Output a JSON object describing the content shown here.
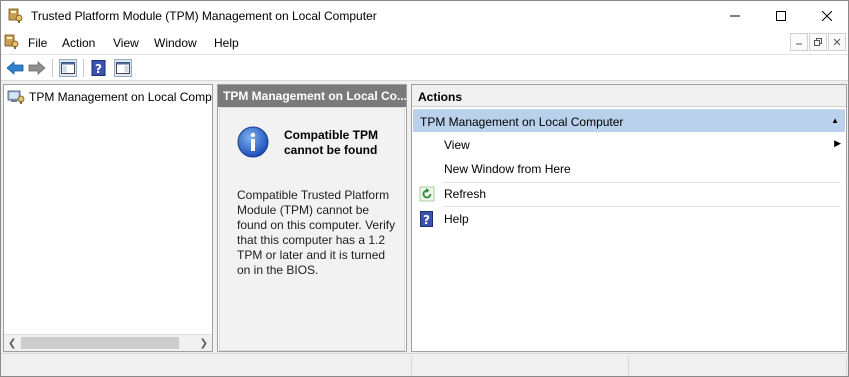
{
  "window": {
    "title": "Trusted Platform Module (TPM) Management on Local Computer",
    "icon": "tpm-key-icon"
  },
  "menu": {
    "items": [
      "File",
      "Action",
      "View",
      "Window",
      "Help"
    ]
  },
  "toolbar": {
    "buttons": [
      "back-arrow-icon",
      "forward-arrow-icon",
      "show-hide-console-tree-icon",
      "help-icon",
      "show-hide-action-pane-icon"
    ]
  },
  "tree": {
    "root_label": "TPM Management on Local Comp"
  },
  "middle": {
    "header": "TPM Management on Local Co...",
    "title": "Compatible TPM cannot be found",
    "message": "Compatible Trusted Platform Module (TPM) cannot be found on this computer. Verify that this computer has a 1.2 TPM or later and it is turned on in the BIOS."
  },
  "actions": {
    "header": "Actions",
    "group_label": "TPM Management on Local Computer",
    "items": {
      "view": "View",
      "new_window": "New Window from Here",
      "refresh": "Refresh",
      "help": "Help"
    }
  },
  "colors": {
    "accent_group_bg": "#b9d1ea",
    "middle_header_bg": "#7a7a7a",
    "back_arrow": "#2f80d0"
  }
}
